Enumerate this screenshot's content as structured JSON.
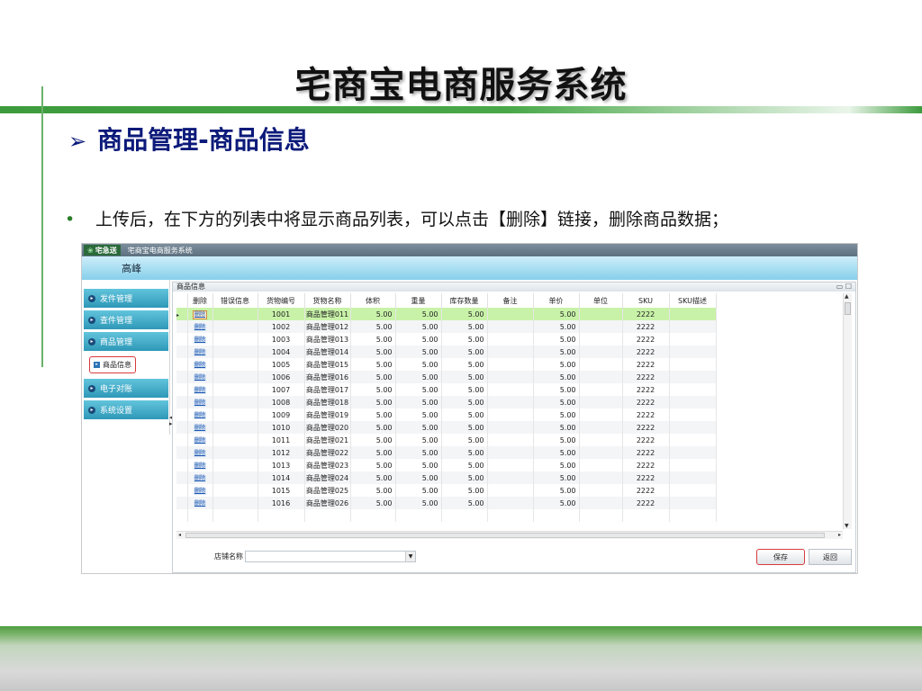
{
  "slide": {
    "title": "宅商宝电商服务系统",
    "section_title": "商品管理-商品信息",
    "bullet": "上传后，在下方的列表中将显示商品列表，可以点击【删除】链接，删除商品数据；"
  },
  "app": {
    "logo_text": "宅急送",
    "logo_sub": "ZJS EXPRESS",
    "window_title": "宅商宝电商服务系统",
    "user_name": "高峰",
    "sidebar": [
      {
        "label": "发件管理"
      },
      {
        "label": "查件管理"
      },
      {
        "label": "商品管理"
      },
      {
        "label": "商品信息"
      },
      {
        "label": "电子对账"
      },
      {
        "label": "系统设置"
      }
    ],
    "panel_title": "商品信息",
    "columns": [
      "删除",
      "错误信息",
      "货物编号",
      "货物名称",
      "体积",
      "重量",
      "库存数量",
      "备注",
      "单价",
      "单位",
      "SKU",
      "SKU描述"
    ],
    "delete_link": "删除",
    "rows": [
      {
        "id": "1001",
        "name": "商品管理011",
        "vol": "5.00",
        "wt": "5.00",
        "stock": "5.00",
        "price": "5.00",
        "sku": "2222"
      },
      {
        "id": "1002",
        "name": "商品管理012",
        "vol": "5.00",
        "wt": "5.00",
        "stock": "5.00",
        "price": "5.00",
        "sku": "2222"
      },
      {
        "id": "1003",
        "name": "商品管理013",
        "vol": "5.00",
        "wt": "5.00",
        "stock": "5.00",
        "price": "5.00",
        "sku": "2222"
      },
      {
        "id": "1004",
        "name": "商品管理014",
        "vol": "5.00",
        "wt": "5.00",
        "stock": "5.00",
        "price": "5.00",
        "sku": "2222"
      },
      {
        "id": "1005",
        "name": "商品管理015",
        "vol": "5.00",
        "wt": "5.00",
        "stock": "5.00",
        "price": "5.00",
        "sku": "2222"
      },
      {
        "id": "1006",
        "name": "商品管理016",
        "vol": "5.00",
        "wt": "5.00",
        "stock": "5.00",
        "price": "5.00",
        "sku": "2222"
      },
      {
        "id": "1007",
        "name": "商品管理017",
        "vol": "5.00",
        "wt": "5.00",
        "stock": "5.00",
        "price": "5.00",
        "sku": "2222"
      },
      {
        "id": "1008",
        "name": "商品管理018",
        "vol": "5.00",
        "wt": "5.00",
        "stock": "5.00",
        "price": "5.00",
        "sku": "2222"
      },
      {
        "id": "1009",
        "name": "商品管理019",
        "vol": "5.00",
        "wt": "5.00",
        "stock": "5.00",
        "price": "5.00",
        "sku": "2222"
      },
      {
        "id": "1010",
        "name": "商品管理020",
        "vol": "5.00",
        "wt": "5.00",
        "stock": "5.00",
        "price": "5.00",
        "sku": "2222"
      },
      {
        "id": "1011",
        "name": "商品管理021",
        "vol": "5.00",
        "wt": "5.00",
        "stock": "5.00",
        "price": "5.00",
        "sku": "2222"
      },
      {
        "id": "1012",
        "name": "商品管理022",
        "vol": "5.00",
        "wt": "5.00",
        "stock": "5.00",
        "price": "5.00",
        "sku": "2222"
      },
      {
        "id": "1013",
        "name": "商品管理023",
        "vol": "5.00",
        "wt": "5.00",
        "stock": "5.00",
        "price": "5.00",
        "sku": "2222"
      },
      {
        "id": "1014",
        "name": "商品管理024",
        "vol": "5.00",
        "wt": "5.00",
        "stock": "5.00",
        "price": "5.00",
        "sku": "2222"
      },
      {
        "id": "1015",
        "name": "商品管理025",
        "vol": "5.00",
        "wt": "5.00",
        "stock": "5.00",
        "price": "5.00",
        "sku": "2222"
      },
      {
        "id": "1016",
        "name": "商品管理026",
        "vol": "5.00",
        "wt": "5.00",
        "stock": "5.00",
        "price": "5.00",
        "sku": "2222"
      }
    ],
    "store_label": "店铺名称",
    "store_value": "",
    "save_label": "保存",
    "back_label": "返回"
  },
  "colors": {
    "accent_green": "#48a848",
    "section_blue": "#0c1a7a",
    "selected_row": "#c8f2a8",
    "sidebar_teal": "#2e98b8"
  }
}
